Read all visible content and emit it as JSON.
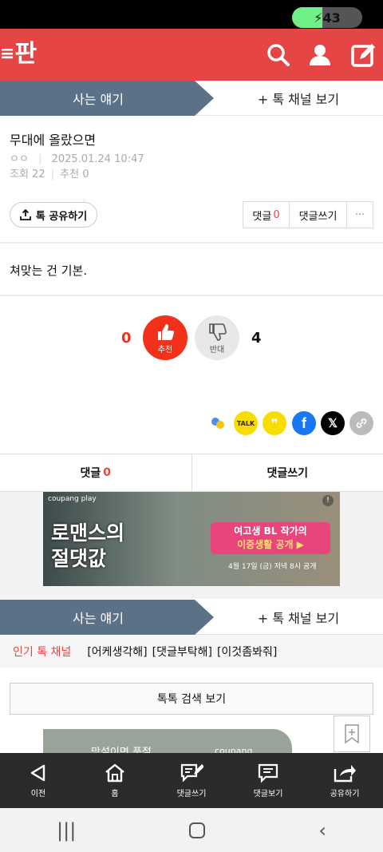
{
  "status": {
    "battery": "43",
    "battery_level": 0.43
  },
  "header": {
    "logo": "판"
  },
  "tabs": {
    "channel": "사는 얘기",
    "view_channel": "+ 톡 채널 보기"
  },
  "post": {
    "title": "무대에 올랐으면",
    "author": "ㅇㅇ",
    "date": "2025.01.24 10:47",
    "views_label": "조회 22",
    "recommend_label": "추천 0",
    "body": "쳐맞는 건 기본."
  },
  "actions": {
    "share": "톡 공유하기",
    "comments_label": "댓글",
    "comments_count": "0",
    "write_comment": "댓글쓰기",
    "more": "···"
  },
  "vote": {
    "up_count": "0",
    "up_label": "추천",
    "down_label": "반대",
    "down_count": "4"
  },
  "social": {
    "kakao_talk": "TALK"
  },
  "comment_bar": {
    "comments_label": "댓글",
    "comments_count": "0",
    "write_comment": "댓글쓰기"
  },
  "ad": {
    "brand": "coupang play",
    "title_line1": "로맨스의",
    "title_line2": "절댓값",
    "tagline1": "여고생 BL 작가의",
    "tagline2": "이중생활 공개 ▶",
    "schedule": "4월 17일 (금) 저녁 8시 공개"
  },
  "popular": {
    "label": "인기 톡 채널",
    "items": [
      "[어케생각해]",
      "[댓글부탁해]",
      "[이것좀봐줘]"
    ]
  },
  "search_button": "톡톡 검색 보기",
  "ad2": {
    "text": "망설이면 품절",
    "brand": "coupang"
  },
  "bottom_nav": {
    "back": "이전",
    "home": "홈",
    "write_comment": "댓글쓰기",
    "view_comments": "댓글보기",
    "share": "공유하기"
  },
  "colors": {
    "brand_red": "#e64545",
    "tab_blue": "#5b7188",
    "recommend_red": "#f2311b"
  }
}
